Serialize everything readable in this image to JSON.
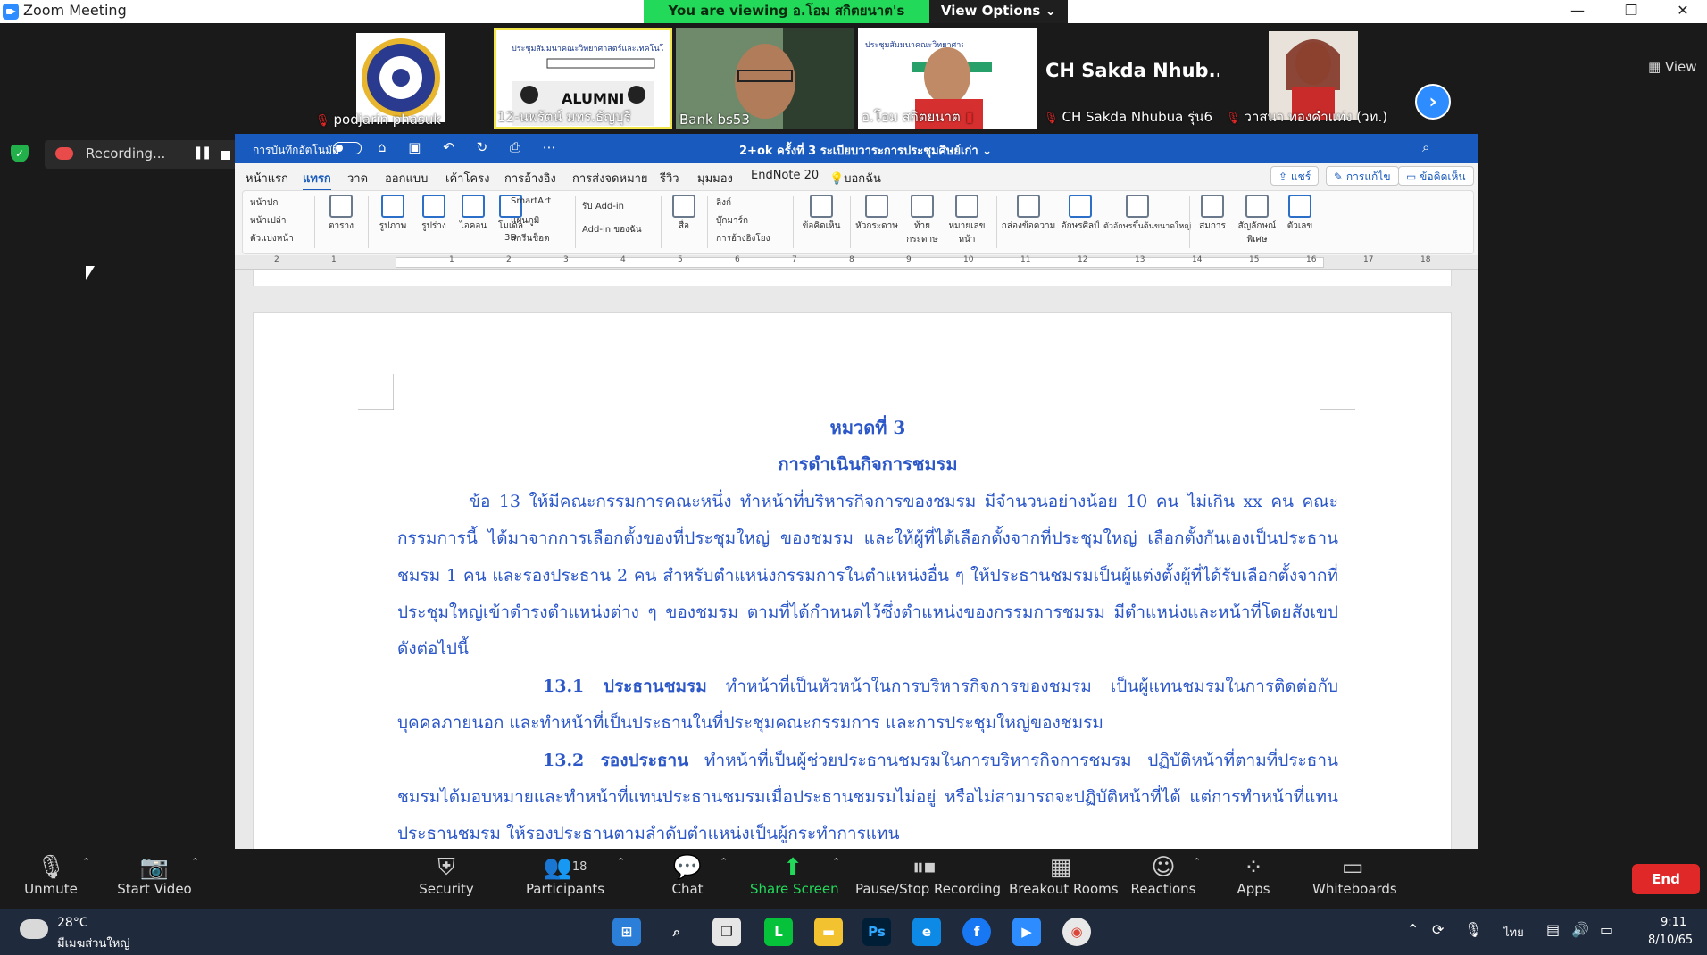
{
  "titlebar": {
    "title": "Zoom Meeting",
    "viewing": "You are viewing อ.โอม สกิตยนาต's screen",
    "view_options": "View Options ⌄",
    "min": "—",
    "max": "❐",
    "close": "✕"
  },
  "thumbnails": [
    {
      "name": "podjarin phasuk"
    },
    {
      "name": "12-นพรัตน์ มทร.ธัญบุรี"
    },
    {
      "name": "Bank bs53"
    },
    {
      "name": "อ.โอม สกิตยนาต"
    },
    {
      "name": "CH Sakda Nhubua รุ่น6",
      "big": "CH Sakda Nhub..."
    },
    {
      "name": "วาสนา ทองคำแท่ง (วท.)"
    }
  ],
  "thumb_tile_text": {
    "alumni": "ALUMNI",
    "poster": "ประชุมสัมมนาคณะวิทยาศาสตร์และเทคโนโลยี"
  },
  "view_label": "View",
  "recording": {
    "label": "Recording..."
  },
  "word": {
    "autosave": "การบันทึกอัตโนมัติ",
    "doc_title": "2+ok ครั้งที่ 3  ระเบียบวาระการประชุมศิษย์เก่า ⌄",
    "tabs": [
      "หน้าแรก",
      "แทรก",
      "วาด",
      "ออกแบบ",
      "เค้าโครง",
      "การอ้างอิง",
      "การส่งจดหมาย",
      "รีวิว",
      "มุมมอง",
      "EndNote 20",
      "บอกฉัน"
    ],
    "share": "แชร์",
    "editing": "การแก้ไข",
    "comments": "ข้อคิดเห็น",
    "ribbon": {
      "pages": [
        "หน้าปก",
        "หน้าเปล่า",
        "ตัวแบ่งหน้า"
      ],
      "table": "ตาราง",
      "pictures": "รูปภาพ",
      "shapes": "รูปร่าง",
      "icons": "ไอคอน",
      "models": "โมเดล 3D",
      "smartart": "SmartArt",
      "chart": "แผนภูมิ",
      "screenshot": "สกรีนช็อต",
      "get_addins": "รับ Add-in",
      "my_addins": "Add-in ของฉัน",
      "media": "สื่อ",
      "link": "ลิงก์",
      "bookmark": "บุ๊กมาร์ก",
      "crossref": "การอ้างอิงโยง",
      "comment": "ข้อคิดเห็น",
      "header": "หัวกระดาษ",
      "footer": "ท้ายกระดาษ",
      "pagenum": "หมายเลขหน้า",
      "textbox": "กล่องข้อความ",
      "wordart": "อักษรศิลป์",
      "dropcap": "ตัวอักษรขึ้นต้นขนาดใหญ่",
      "equation": "สมการ",
      "symbol": "สัญลักษณ์พิเศษ",
      "number": "ตัวเลข"
    },
    "ruler": [
      "2",
      "1",
      "1",
      "2",
      "3",
      "4",
      "5",
      "6",
      "7",
      "8",
      "9",
      "10",
      "11",
      "12",
      "13",
      "14",
      "15",
      "16",
      "17",
      "18"
    ]
  },
  "document": {
    "heading1": "หมวดที่ 3",
    "heading2": "การดำเนินกิจการชมรม",
    "para1": "ข้อ 13 ให้มีคณะกรรมการคณะหนึ่ง ทำหน้าที่บริหารกิจการของชมรม มีจำนวนอย่างน้อย 10 คน ไม่เกิน xx คน คณะกรรมการนี้ ได้มาจากการเลือกตั้งของที่ประชุมใหญ่ ของชมรม และให้ผู้ที่ได้เลือกตั้งจากที่ประชุมใหญ่ เลือกตั้งกันเองเป็นประธานชมรม 1 คน และรองประธาน 2 คน สำหรับตำแหน่งกรรมการในตำแหน่งอื่น ๆ ให้ประธานชมรมเป็นผู้แต่งตั้งผู้ที่ได้รับเลือกตั้งจากที่ประชุมใหญ่เข้าดำรงตำแหน่งต่าง ๆ ของชมรม ตามที่ได้กำหนดไว้ซึ่งตำแหน่งของกรรมการชมรม มีตำแหน่งและหน้าที่โดยสังเขปดังต่อไปนี้",
    "p131_label": "13.1 ประธานชมรม",
    "p131_text": " ทำหน้าที่เป็นหัวหน้าในการบริหารกิจการของชมรม เป็นผู้แทนชมรมในการติดต่อกับบุคคลภายนอก และทำหน้าที่เป็นประธานในที่ประชุมคณะกรรมการ และการประชุมใหญ่ของชมรม",
    "p132_label": "13.2  รองประธาน",
    "p132_text": "  ทำหน้าที่เป็นผู้ช่วยประธานชมรมในการบริหารกิจการชมรม  ปฏิบัติหน้าที่ตามที่ประธานชมรมได้มอบหมายและทำหน้าที่แทนประธานชมรมเมื่อประธานชมรมไม่อยู่   หรือไม่สามารถจะปฏิบัติหน้าที่ได้   แต่การทำหน้าที่แทนประธานชมรม ให้รองประธานตามลำดับตำแหน่งเป็นผู้กระทำการแทน"
  },
  "toolbar": {
    "unmute": "Unmute",
    "start_video": "Start Video",
    "security": "Security",
    "participants": "Participants",
    "participant_count": "18",
    "chat": "Chat",
    "share_screen": "Share Screen",
    "pause_stop": "Pause/Stop Recording",
    "breakout": "Breakout Rooms",
    "reactions": "Reactions",
    "apps": "Apps",
    "whiteboards": "Whiteboards",
    "end": "End"
  },
  "taskbar": {
    "temp": "28°C",
    "weather": "มีเมฆส่วนใหญ่",
    "lang": "ไทย",
    "time": "9:11",
    "date": "8/10/65",
    "ps": "Ps"
  }
}
